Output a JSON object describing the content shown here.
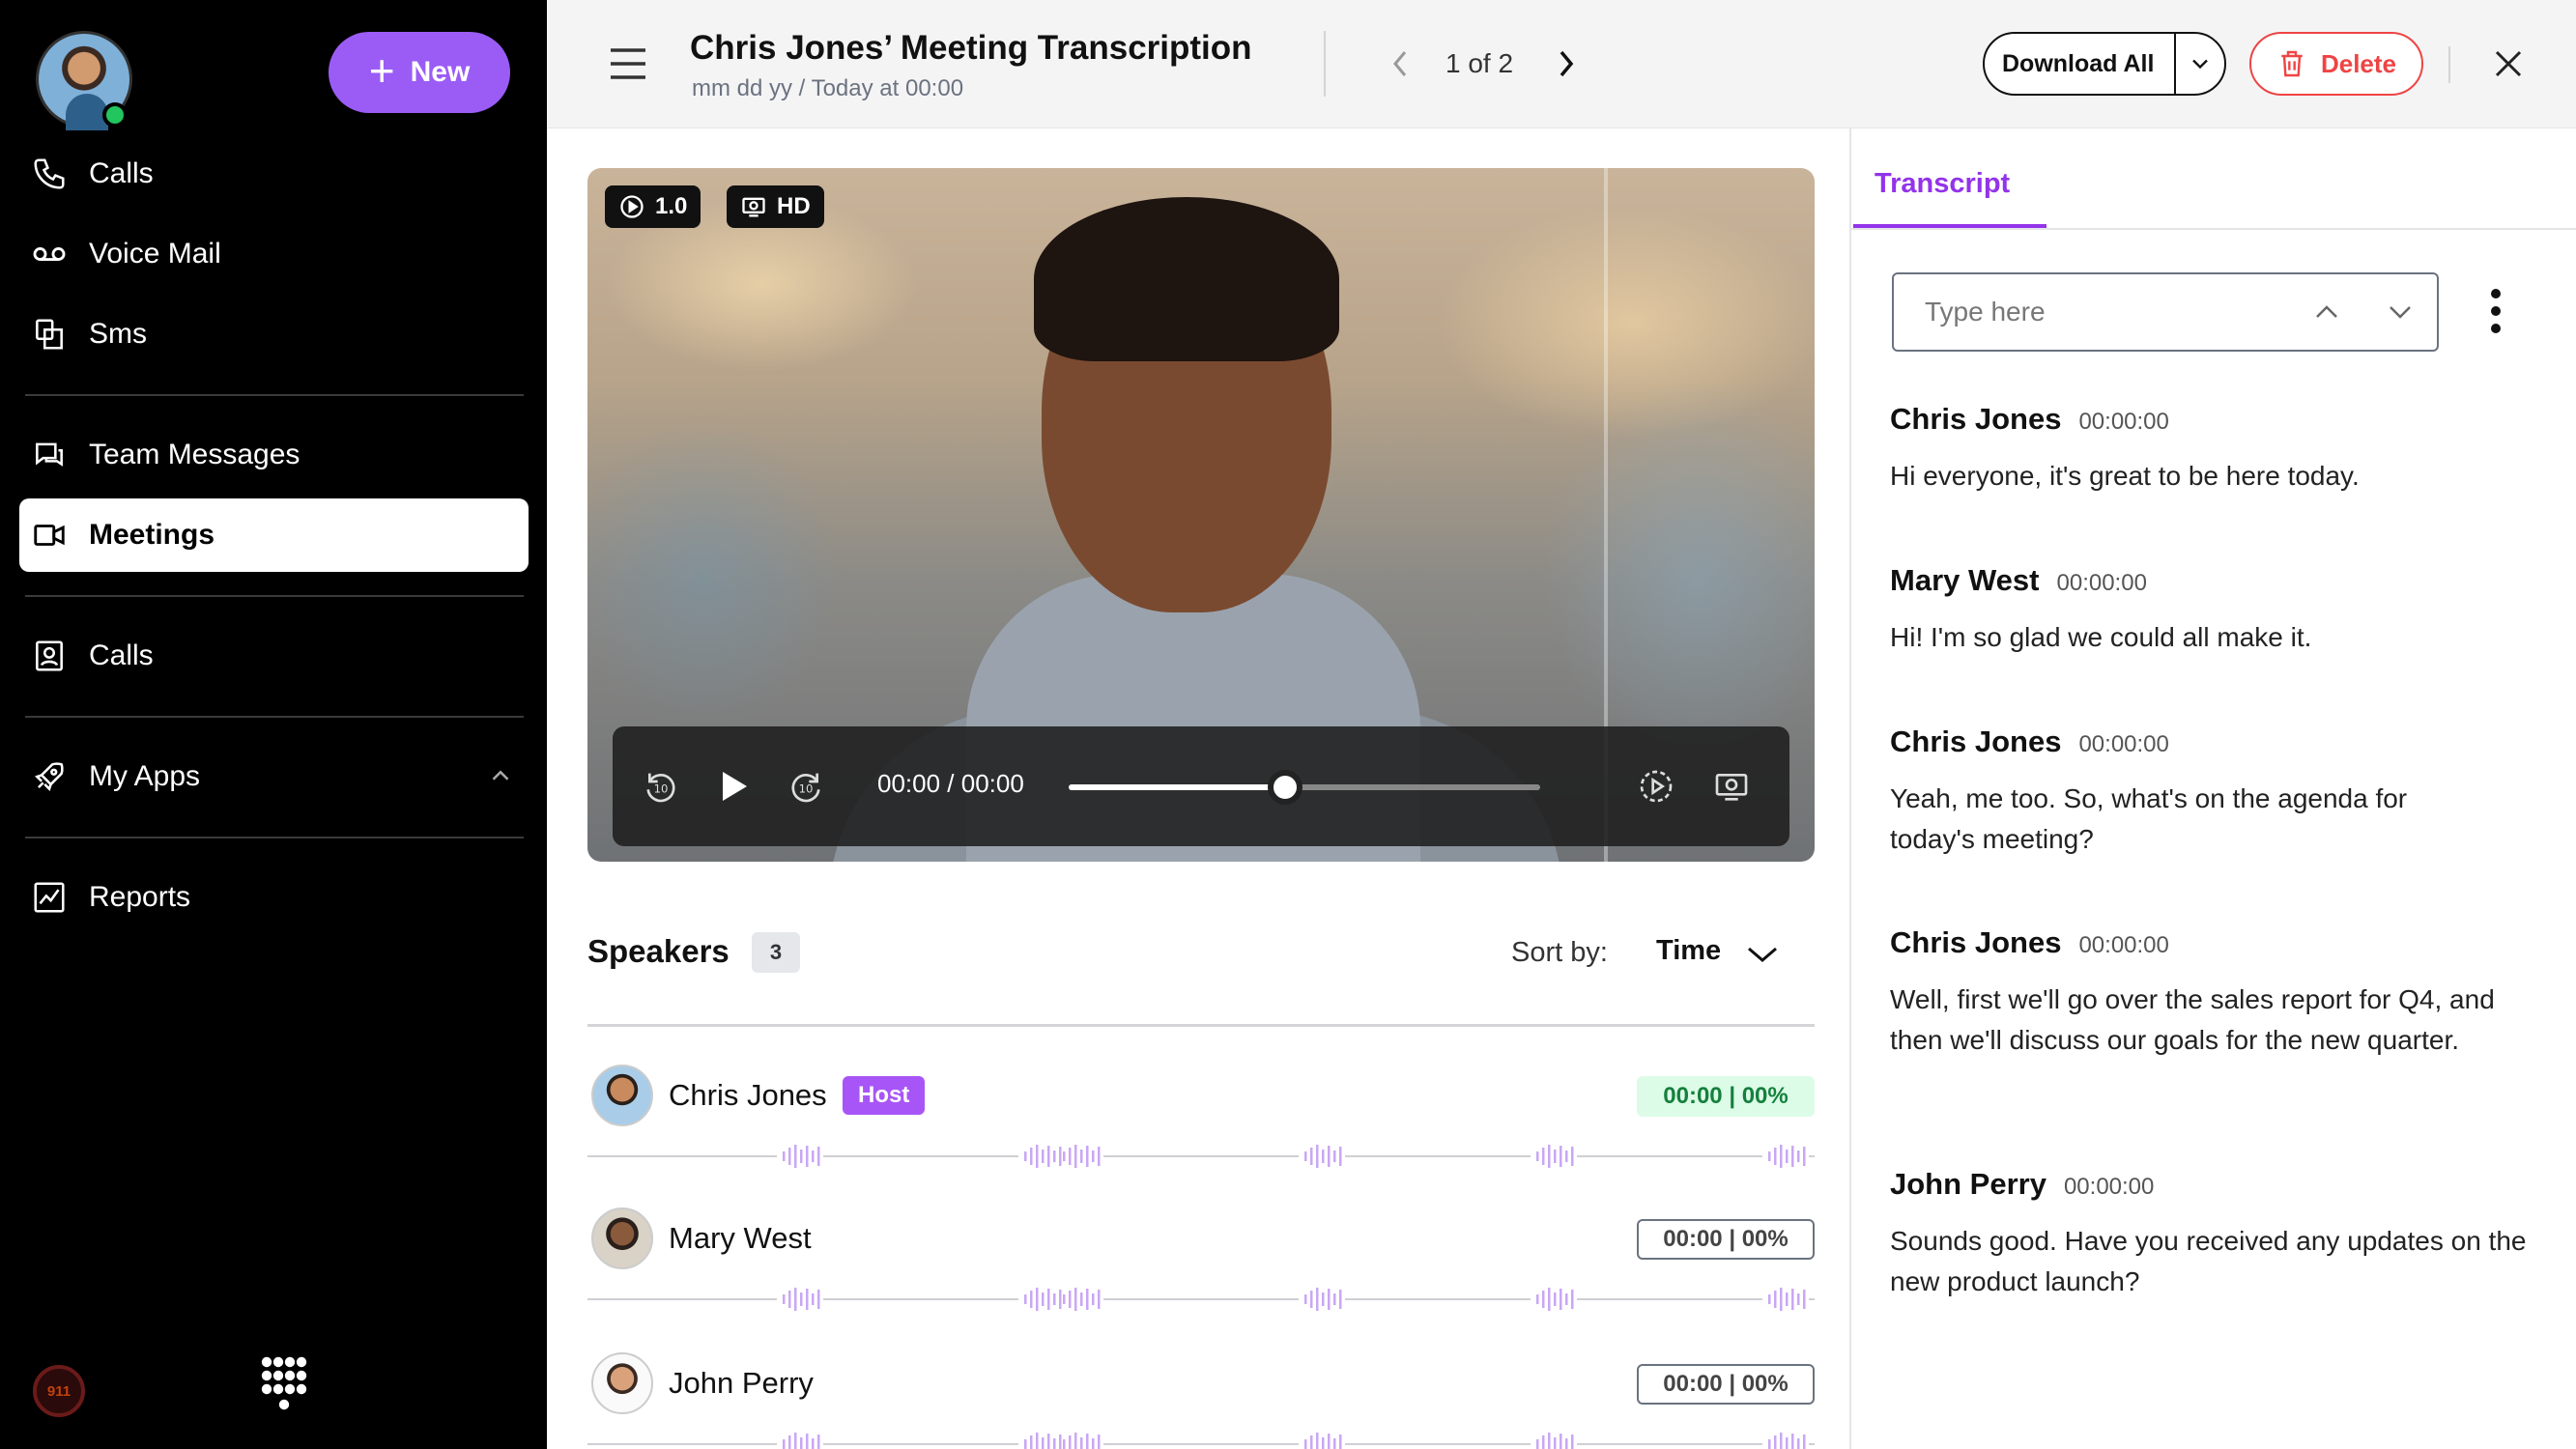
{
  "sidebar": {
    "new_button": "New",
    "items": [
      {
        "label": "Calls",
        "icon": "phone-icon"
      },
      {
        "label": "Voice Mail",
        "icon": "voicemail-icon"
      },
      {
        "label": "Sms",
        "icon": "sms-icon"
      },
      {
        "label": "Team Messages",
        "icon": "chat-icon"
      },
      {
        "label": "Meetings",
        "icon": "video-icon",
        "active": true
      },
      {
        "label": "Calls",
        "icon": "contact-card-icon"
      },
      {
        "label": "My Apps",
        "icon": "rocket-icon"
      },
      {
        "label": "Reports",
        "icon": "chart-icon"
      }
    ],
    "emergency": "911"
  },
  "header": {
    "title": "Chris Jones’ Meeting Transcription",
    "subtitle": "mm dd yy / Today at 00:00",
    "pager": "1 of 2",
    "download_all": "Download All",
    "delete": "Delete"
  },
  "video": {
    "speed": "1.0",
    "quality": "HD",
    "time": "00:00 / 00:00",
    "progress": 0.46
  },
  "speakers": {
    "title": "Speakers",
    "count": "3",
    "sort_label": "Sort by:",
    "sort_value": "Time",
    "list": [
      {
        "name": "Chris Jones",
        "host": "Host",
        "stat": "00:00 | 00%"
      },
      {
        "name": "Mary West",
        "stat": "00:00 | 00%"
      },
      {
        "name": "John Perry",
        "stat": "00:00 | 00%"
      }
    ]
  },
  "transcript": {
    "tab": "Transcript",
    "search_placeholder": "Type here",
    "entries": [
      {
        "speaker": "Chris Jones",
        "time": "00:00:00",
        "text": "Hi everyone, it's great to be here today."
      },
      {
        "speaker": "Mary West",
        "time": "00:00:00",
        "text": "Hi! I'm so glad we could all make it."
      },
      {
        "speaker": "Chris Jones",
        "time": "00:00:00",
        "text": "Yeah, me too. So, what's on the agenda for today's meeting?"
      },
      {
        "speaker": "Chris Jones",
        "time": "00:00:00",
        "text": "Well, first we'll go over the sales report for Q4, and then we'll discuss our goals for the new quarter."
      },
      {
        "speaker": "John Perry",
        "time": "00:00:00",
        "text": "Sounds good. Have you received any updates on the new product launch?"
      }
    ]
  },
  "colors": {
    "accent": "#9b5cf6",
    "danger": "#ef4444",
    "success": "#15803d"
  }
}
